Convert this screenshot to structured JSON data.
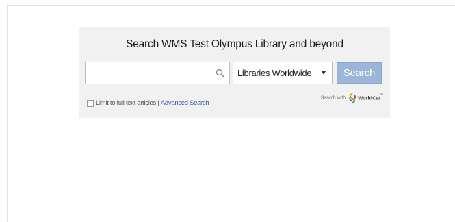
{
  "widget": {
    "title": "Search WMS Test Olympus Library and beyond",
    "search": {
      "value": "",
      "placeholder": ""
    },
    "scope": {
      "selected": "Libraries Worldwide"
    },
    "search_button_label": "Search",
    "limit": {
      "label": "Limit to full text articles",
      "separator": "|",
      "checked": false
    },
    "advanced_link_label": "Advanced Search",
    "powered_by": {
      "label": "Search with",
      "brand": "WorldCat",
      "mark": "®"
    }
  },
  "colors": {
    "widget_bg": "#f1f1f1",
    "button_bg": "#9cb6d9",
    "link": "#2f5fa8"
  },
  "icons": [
    "magnifier-icon",
    "dropdown-arrow-icon",
    "worldcat-logo-icon"
  ]
}
